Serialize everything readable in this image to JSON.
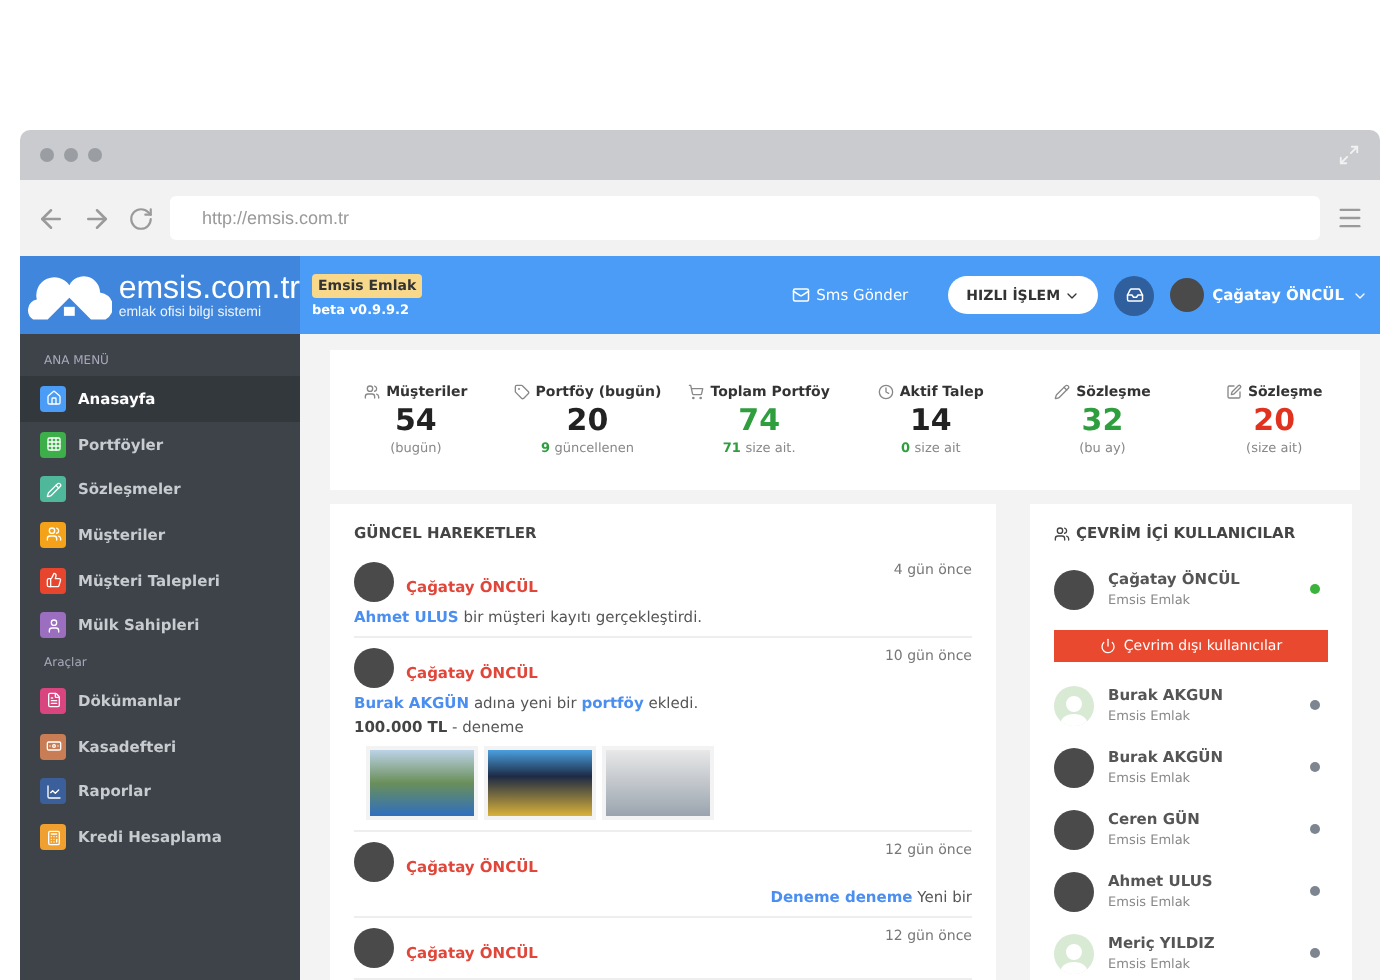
{
  "browser": {
    "url": "http://emsis.com.tr"
  },
  "header": {
    "logo_title": "emsis.com.tr",
    "logo_subtitle": "emlak ofisi bilgi sistemi",
    "company_badge": "Emsis Emlak",
    "version": "beta v0.9.9.2",
    "sms_label": "Sms Gönder",
    "quick_button": "HIZLI İŞLEM",
    "user_name": "Çağatay ÖNCÜL"
  },
  "sidebar": {
    "sections": [
      {
        "title": "ANA MENÜ",
        "items": [
          {
            "label": "Anasayfa",
            "color": "#4a9cf7",
            "selected": true
          },
          {
            "label": "Portföyler",
            "color": "#3cae4a",
            "selected": false
          },
          {
            "label": "Sözleşmeler",
            "color": "#4fb89a",
            "selected": false
          },
          {
            "label": "Müşteriler",
            "color": "#f5a21b",
            "selected": false
          },
          {
            "label": "Müşteri Talepleri",
            "color": "#e8452f",
            "selected": false
          },
          {
            "label": "Mülk Sahipleri",
            "color": "#9b6ec0",
            "selected": false
          }
        ]
      },
      {
        "title": "Araçlar",
        "items": [
          {
            "label": "Dökümanlar",
            "color": "#d9457f",
            "selected": false
          },
          {
            "label": "Kasadefteri",
            "color": "#c87d55",
            "selected": false
          },
          {
            "label": "Raporlar",
            "color": "#3b5f9a",
            "selected": false
          },
          {
            "label": "Kredi Hesaplama",
            "color": "#f0a02e",
            "selected": false
          }
        ]
      }
    ]
  },
  "stats": [
    {
      "label": "Müşteriler",
      "value": "54",
      "color": "#222222",
      "note": "(bugün)"
    },
    {
      "label": "Portföy (bugün)",
      "value": "20",
      "color": "#222222",
      "note_highlight": "9",
      "note": "güncellenen"
    },
    {
      "label": "Toplam Portföy",
      "value": "74",
      "color": "#2e9e3e",
      "note_highlight": "71",
      "note": "size ait."
    },
    {
      "label": "Aktif Talep",
      "value": "14",
      "color": "#222222",
      "note_highlight": "0",
      "note": "size ait"
    },
    {
      "label": "Sözleşme",
      "value": "32",
      "color": "#2e9e3e",
      "note": "(bu ay)"
    },
    {
      "label": "Sözleşme",
      "value": "20",
      "color": "#e0321e",
      "note": "(size ait)"
    }
  ],
  "activity": {
    "title": "GÜNCEL HAREKETLER",
    "items": [
      {
        "kind": "customer",
        "author": "Çağatay ÖNCÜL",
        "time": "4 gün önce",
        "message": [
          {
            "text": "Ahmet ULUS",
            "link": true
          },
          {
            "text": " bir müşteri kayıtı gerçekleştirdi.",
            "link": false
          }
        ]
      },
      {
        "kind": "portfolio",
        "author": "Çağatay ÖNCÜL",
        "time": "10 gün önce",
        "message": [
          {
            "text": "Burak AKGÜN",
            "link": true
          },
          {
            "text": " adına yeni bir ",
            "link": false
          },
          {
            "text": "portföy",
            "link": true
          },
          {
            "text": " ekledi.",
            "link": false
          }
        ],
        "price": "100.000 TL",
        "detail": " - deneme",
        "photos": [
          {
            "kind": "pool"
          },
          {
            "kind": "building"
          },
          {
            "kind": "interior"
          }
        ]
      },
      {
        "kind": "note",
        "author": "Çağatay ÖNCÜL",
        "time": "12 gün önce",
        "message": [
          {
            "text": "Deneme deneme",
            "link": true
          },
          {
            "text": " Yeni bir",
            "link": false
          }
        ]
      },
      {
        "author": "Çağatay ÖNCÜL",
        "time": "12 gün önce"
      }
    ]
  },
  "online": {
    "title": "ÇEVRİM İÇİ KULLANICILAR",
    "offline_button": "Çevrim dışı kullanıcılar",
    "users": [
      {
        "name": "Çağatay ÖNCÜL",
        "company": "Emsis Emlak",
        "online": true,
        "kind": "photo"
      },
      {
        "name": "Burak AKGUN",
        "company": "Emsis Emlak",
        "online": false,
        "kind": "placeholder"
      },
      {
        "name": "Burak AKGÜN",
        "company": "Emsis Emlak",
        "online": false,
        "kind": "photo"
      },
      {
        "name": "Ceren GÜN",
        "company": "Emsis Emlak",
        "online": false,
        "kind": "photo"
      },
      {
        "name": "Ahmet ULUS",
        "company": "Emsis Emlak",
        "online": false,
        "kind": "photo"
      },
      {
        "name": "Meriç YILDIZ",
        "company": "Emsis Emlak",
        "online": false,
        "kind": "placeholder"
      }
    ]
  }
}
